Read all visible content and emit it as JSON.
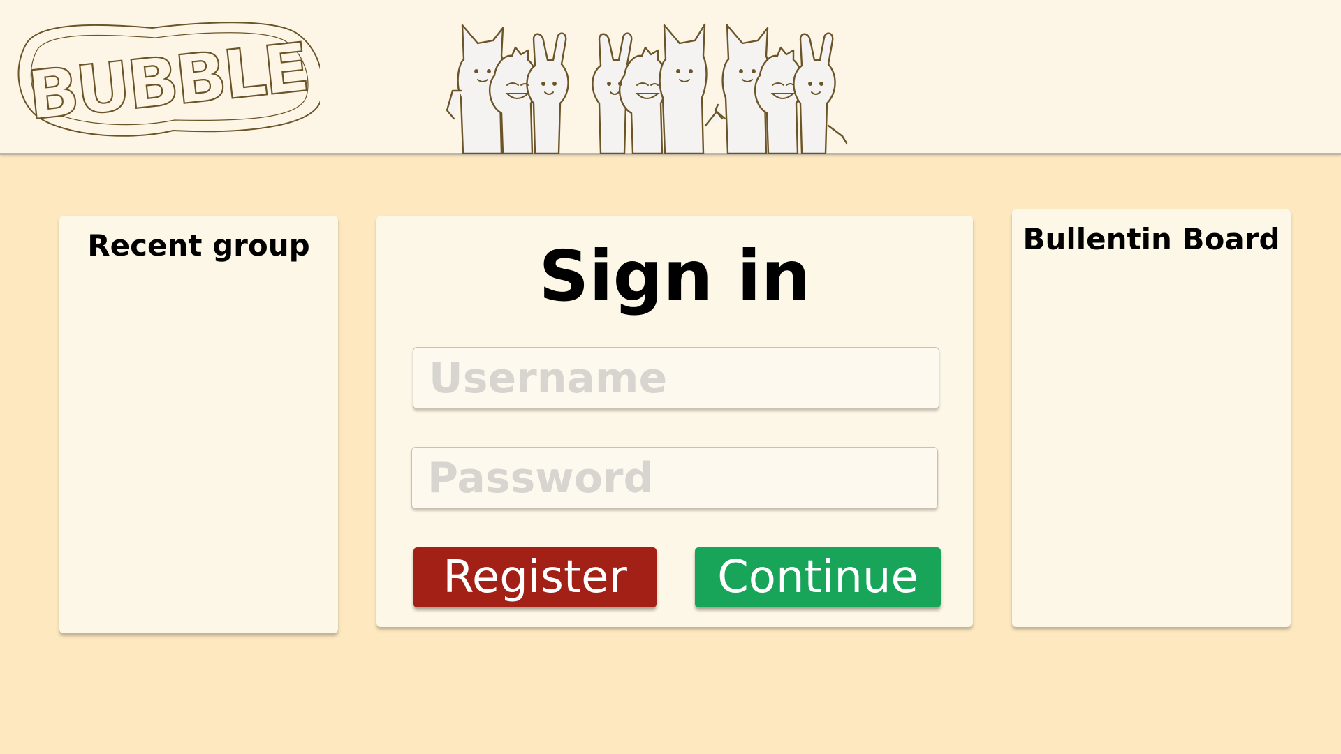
{
  "header": {
    "logo_text": "BUBBLE",
    "mascot_illustration": "friends-banner-illustration"
  },
  "recent_panel": {
    "title": "Recent group"
  },
  "signin": {
    "title": "Sign in",
    "username_placeholder": "Username",
    "username_value": "",
    "password_placeholder": "Password",
    "password_value": "",
    "register_label": "Register",
    "continue_label": "Continue"
  },
  "bulletin_panel": {
    "title": "Bullentin Board"
  },
  "colors": {
    "page_background": "#fde8bf",
    "header_background": "#fdf6e7",
    "panel_background": "#fdf7e8",
    "register_button": "#a32016",
    "continue_button": "#18a55a",
    "line_art": "#6b5427"
  }
}
